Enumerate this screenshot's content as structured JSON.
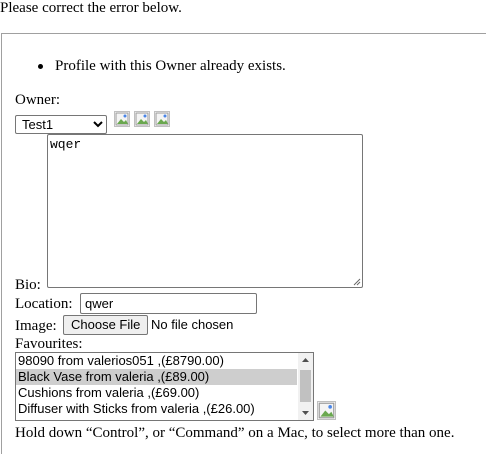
{
  "error_title": "Please correct the error below.",
  "errors": [
    "Profile with this Owner already exists."
  ],
  "owner": {
    "label": "Owner:",
    "selected": "Test1",
    "icons": [
      "change-related-icon",
      "add-related-icon",
      "view-related-icon"
    ]
  },
  "bio": {
    "label": "Bio:",
    "value": "wqer"
  },
  "location": {
    "label": "Location:",
    "value": "qwer"
  },
  "image": {
    "label": "Image:",
    "button": "Choose File",
    "status": "No file chosen"
  },
  "favourites": {
    "label": "Favourites:",
    "options": [
      {
        "text": "98090 from valerios051 ,(£8790.00)",
        "selected": false
      },
      {
        "text": "Black Vase from valeria ,(£89.00)",
        "selected": true
      },
      {
        "text": "Cushions from valeria ,(£69.00)",
        "selected": false
      },
      {
        "text": "Diffuser with Sticks from valeria ,(£26.00)",
        "selected": false
      }
    ],
    "icon": "add-related-icon",
    "help": "Hold down “Control”, or “Command” on a Mac, to select more than one."
  }
}
